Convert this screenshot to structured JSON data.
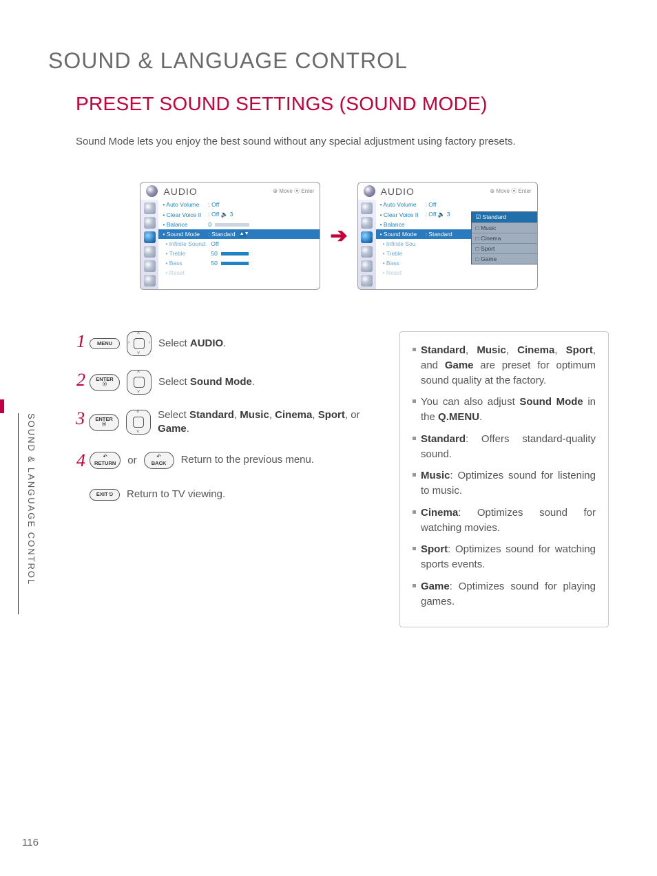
{
  "page_number": "116",
  "side_tab": "SOUND & LANGUAGE CONTROL",
  "title": "SOUND & LANGUAGE CONTROL",
  "subtitle": "PRESET SOUND SETTINGS (SOUND MODE)",
  "intro": "Sound Mode lets you enjoy the best sound without any special adjustment using factory presets.",
  "osd": {
    "header": "AUDIO",
    "hints": "⊕ Move   ⦿ Enter",
    "items": {
      "auto_volume": {
        "label": "• Auto Volume",
        "value": ": Off"
      },
      "clear_voice": {
        "label": "• Clear Voice II",
        "value": ": Off  🔈 3"
      },
      "balance": {
        "label": "• Balance",
        "value": "0"
      },
      "sound_mode": {
        "label": "• Sound Mode",
        "value": ": Standard"
      },
      "infinite": {
        "label": "• Infinite Sound:",
        "value": "Off"
      },
      "treble": {
        "label": "• Treble",
        "value": "50"
      },
      "bass": {
        "label": "• Bass",
        "value": "50"
      },
      "reset": {
        "label": "• Reset",
        "value": ""
      }
    },
    "popup": [
      "Standard",
      "Music",
      "Cinema",
      "Sport",
      "Game"
    ]
  },
  "steps": {
    "s1": {
      "btn": "MENU",
      "pad": "lr",
      "text_pre": "Select ",
      "bold": "AUDIO",
      "text_post": "."
    },
    "s2": {
      "btn": "ENTER",
      "pad": "ud",
      "text_pre": "Select ",
      "bold": "Sound Mode",
      "text_post": "."
    },
    "s3": {
      "btn": "ENTER",
      "pad": "ud",
      "text_pre": "Select ",
      "bold": "Standard",
      "mid": ", ",
      "b2": "Music",
      "mid2": ", ",
      "b3": "Cinema",
      "mid3": ", ",
      "b4": "Sport",
      "mid4": ", or ",
      "b5": "Game",
      "text_post": "."
    },
    "s4": {
      "btn1": "RETURN",
      "or": "or",
      "btn2": "BACK",
      "text": "Return to the previous menu."
    },
    "exit": {
      "btn": "EXIT",
      "text": "Return to TV viewing."
    }
  },
  "info": {
    "l1": {
      "b1": "Standard",
      "t1": ", ",
      "b2": "Music",
      "t2": ", ",
      "b3": "Cinema",
      "t3": ", ",
      "b4": "Sport",
      "t4": ", and ",
      "b5": "Game",
      "t5": " are preset for optimum sound quality at the factory."
    },
    "l2": {
      "t1": "You can also adjust ",
      "b1": "Sound Mode",
      "t2": " in the ",
      "b2": "Q.MENU",
      "t3": "."
    },
    "l3": {
      "b1": "Standard",
      "t1": ": Offers standard-quality sound."
    },
    "l4": {
      "b1": "Music",
      "t1": ": Optimizes sound for listening to music."
    },
    "l5": {
      "b1": "Cinema",
      "t1": ": Optimizes sound for watching movies."
    },
    "l6": {
      "b1": "Sport",
      "t1": ": Optimizes sound for watching sports events."
    },
    "l7": {
      "b1": "Game",
      "t1": ": Optimizes sound for playing games."
    }
  }
}
